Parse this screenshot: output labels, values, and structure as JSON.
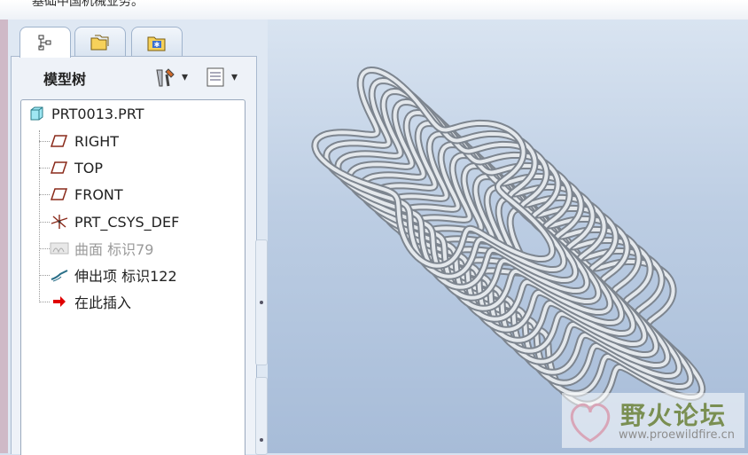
{
  "topbar": {
    "message": "基础中国机械业务。"
  },
  "tabs": [
    {
      "name": "model-tree",
      "icon": "model-tree-icon"
    },
    {
      "name": "folders",
      "icon": "folder-browser-icon"
    },
    {
      "name": "favorites",
      "icon": "favorites-folder-icon"
    }
  ],
  "panel": {
    "title": "模型树",
    "settings_icon": "tools-settings-icon",
    "view_icon": "show-options-icon"
  },
  "tree": {
    "items": [
      {
        "label": "PRT0013.PRT",
        "icon": "part-icon",
        "dim": false
      },
      {
        "label": "RIGHT",
        "icon": "datum-plane-icon",
        "dim": false
      },
      {
        "label": "TOP",
        "icon": "datum-plane-icon",
        "dim": false
      },
      {
        "label": "FRONT",
        "icon": "datum-plane-icon",
        "dim": false
      },
      {
        "label": "PRT_CSYS_DEF",
        "icon": "coordinate-system-icon",
        "dim": false
      },
      {
        "label": "曲面 标识79",
        "icon": "surface-icon",
        "dim": true
      },
      {
        "label": "伸出项 标识122",
        "icon": "protrusion-icon",
        "dim": false
      },
      {
        "label": "在此插入",
        "icon": "insert-here-arrow-icon",
        "dim": false
      }
    ]
  },
  "watermark": {
    "title": "野火论坛",
    "url": "www.proewildfire.cn"
  },
  "colors": {
    "accent": "#7a8f52",
    "plane": "#8a2a1a",
    "insert_arrow": "#e00000"
  }
}
